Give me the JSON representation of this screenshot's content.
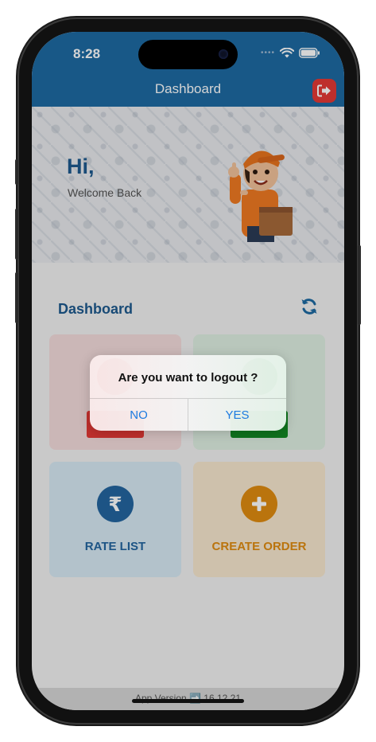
{
  "status_bar": {
    "time": "8:28"
  },
  "header": {
    "title": "Dashboard"
  },
  "banner": {
    "greeting": "Hi,",
    "subtitle": "Welcome Back"
  },
  "dashboard": {
    "section_title": "Dashboard",
    "tiles": [
      {
        "label": "RATE LIST",
        "color": "#2466a0",
        "icon": "rupee-icon"
      },
      {
        "label": "CREATE ORDER",
        "color": "#e08c10",
        "icon": "plus-icon"
      }
    ]
  },
  "dialog": {
    "message": "Are you want to logout ?",
    "no_label": "NO",
    "yes_label": "YES"
  },
  "footer": {
    "version_text": "App Version ➡️ 16.12.21"
  },
  "colors": {
    "primary": "#1d6aa3",
    "logout_red": "#e53935",
    "dialog_button": "#1e7be0"
  }
}
